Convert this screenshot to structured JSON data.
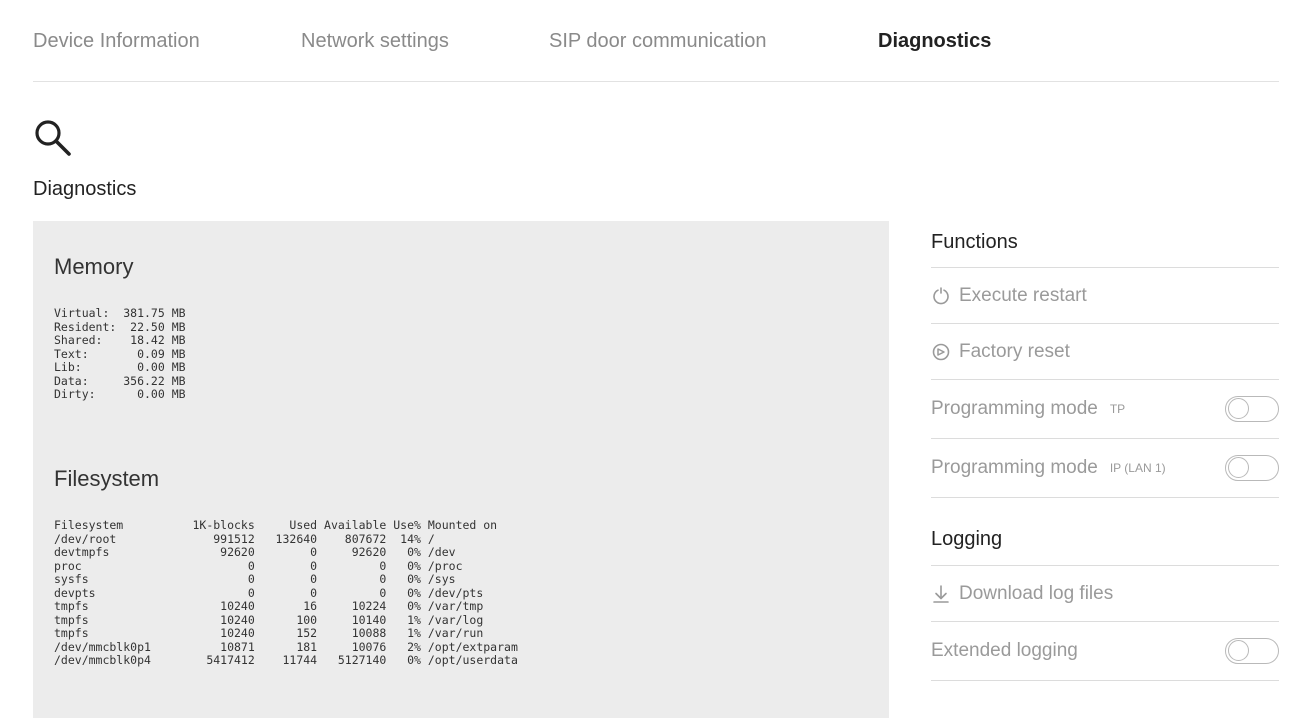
{
  "tabs": [
    {
      "label": "Device Information"
    },
    {
      "label": "Network settings"
    },
    {
      "label": "SIP door communication"
    },
    {
      "label": "Diagnostics",
      "active": true
    }
  ],
  "page": {
    "title": "Diagnostics",
    "icon": "search-icon"
  },
  "memory": {
    "title": "Memory",
    "text": "Virtual:  381.75 MB\nResident:  22.50 MB\nShared:    18.42 MB\nText:       0.09 MB\nLib:        0.00 MB\nData:     356.22 MB\nDirty:      0.00 MB"
  },
  "filesystem": {
    "title": "Filesystem",
    "text": "Filesystem          1K-blocks     Used Available Use% Mounted on\n/dev/root              991512   132640    807672  14% /\ndevtmpfs                92620        0     92620   0% /dev\nproc                        0        0         0   0% /proc\nsysfs                       0        0         0   0% /sys\ndevpts                      0        0         0   0% /dev/pts\ntmpfs                   10240       16     10224   0% /var/tmp\ntmpfs                   10240      100     10140   1% /var/log\ntmpfs                   10240      152     10088   1% /var/run\n/dev/mmcblk0p1          10871      181     10076   2% /opt/extparam\n/dev/mmcblk0p4        5417412    11744   5127140   0% /opt/userdata"
  },
  "functions": {
    "title": "Functions",
    "execute_restart": {
      "label": "Execute restart",
      "icon": "restart-icon"
    },
    "factory_reset": {
      "label": "Factory reset",
      "icon": "factory-reset-icon"
    },
    "programming_tp": {
      "label": "Programming mode",
      "suffix": "TP",
      "enabled": false
    },
    "programming_ip": {
      "label": "Programming mode",
      "suffix": "IP (LAN 1)",
      "enabled": false
    }
  },
  "logging": {
    "title": "Logging",
    "download": {
      "label": "Download log files",
      "icon": "download-icon"
    },
    "extended": {
      "label": "Extended logging",
      "enabled": false
    }
  },
  "colors": {
    "panel_bg": "#ececec",
    "muted_text": "#9a9a9a",
    "active_tab": "#222222"
  }
}
